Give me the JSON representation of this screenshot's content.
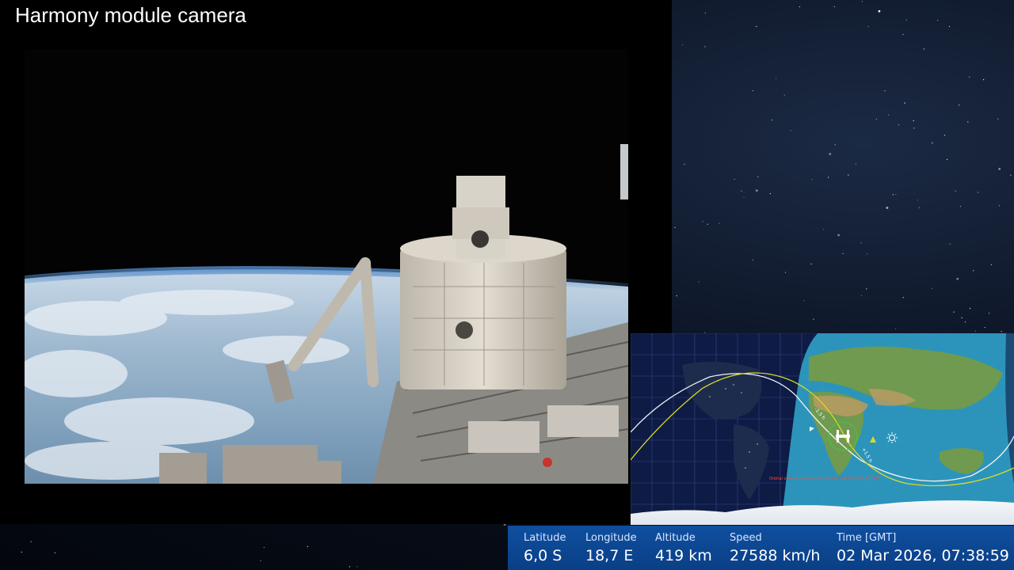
{
  "title": "Harmony module camera",
  "map": {
    "orbit_caption": "Orbital solar eclipse epoch: 01 Mar 2026, 07:38:59 GMT",
    "orbit_marker_labels": [
      "-1.5 h",
      "+1.5 h"
    ],
    "colors": {
      "night": "#0e1b45",
      "day": "#2f9ec4",
      "track": "#f0f2f5",
      "track_future": "#d7d92a"
    }
  },
  "telemetry": {
    "latitude": {
      "label": "Latitude",
      "value": "6,0 S"
    },
    "longitude": {
      "label": "Longitude",
      "value": "18,7 E"
    },
    "altitude": {
      "label": "Altitude",
      "value": "419 km"
    },
    "speed": {
      "label": "Speed",
      "value": "27588 km/h"
    },
    "time": {
      "label": "Time [GMT]",
      "value": "02 Mar 2026, 07:38:59"
    }
  },
  "colors": {
    "telemetry_bg": "#0c4692",
    "title_text": "#ffffff"
  },
  "icons": {
    "iss": "iss-icon",
    "sun": "sun-icon"
  }
}
